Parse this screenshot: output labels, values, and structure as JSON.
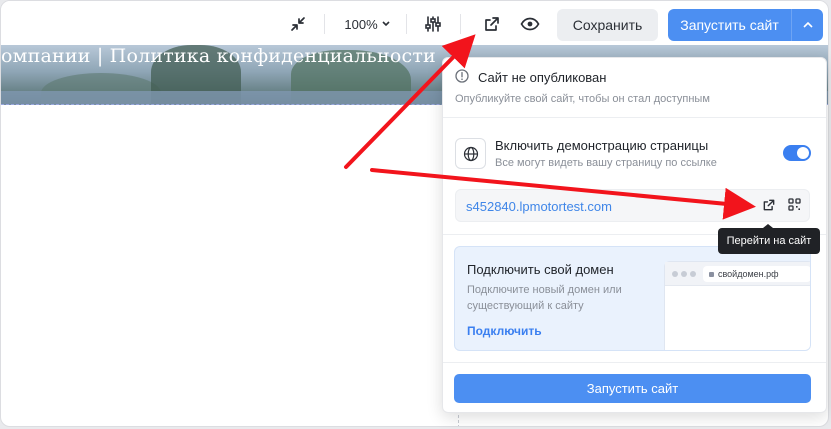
{
  "toolbar": {
    "zoom_value": "100%",
    "save_label": "Сохранить",
    "launch_label": "Запустить сайт"
  },
  "canvas": {
    "hero_text": "омпании | Политика конфиденциальности"
  },
  "panel": {
    "status_title": "Сайт не опубликован",
    "status_sub": "Опубликуйте свой сайт, чтобы он стал доступным",
    "demo_title": "Включить демонстрацию страницы",
    "demo_sub": "Все могут видеть вашу страницу по ссылке",
    "demo_enabled": true,
    "url": "s452840.lpmotortest.com",
    "domain_title": "Подключить свой домен",
    "domain_sub": "Подключите новый домен или существующий к сайту",
    "domain_link": "Подключить",
    "domain_example": "свойдомен.рф",
    "launch_button": "Запустить сайт"
  },
  "tooltip": {
    "text": "Перейти на сайт"
  },
  "colors": {
    "accent": "#4c8ff2",
    "link": "#3f86e8",
    "annotation_arrow": "#f2141c"
  },
  "icons": [
    "collapse-icon",
    "chevron-down-icon",
    "sliders-icon",
    "external-link-icon",
    "eye-icon",
    "info-icon",
    "globe-icon",
    "qr-code-icon"
  ]
}
